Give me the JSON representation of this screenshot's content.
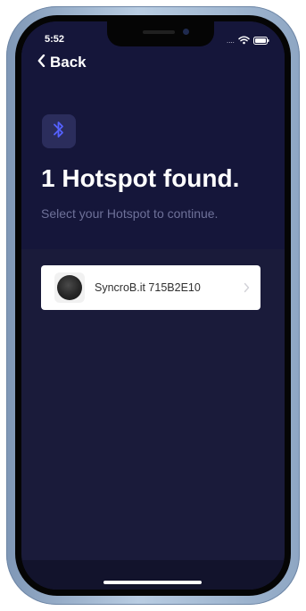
{
  "status_bar": {
    "time": "5:52",
    "signal_text": "....",
    "wifi_icon": "wifi-icon",
    "battery_icon": "battery-icon"
  },
  "navigation": {
    "back_label": "Back",
    "back_icon": "chevron-left-icon"
  },
  "header": {
    "icon": "bluetooth-icon",
    "title": "1 Hotspot found.",
    "subtitle": "Select your Hotspot to continue."
  },
  "hotspots": [
    {
      "name": "SyncroB.it 715B2E10",
      "icon": "hotspot-device-icon",
      "chevron": "chevron-right-icon"
    }
  ],
  "colors": {
    "screen_background": "#1a1b3a",
    "header_background": "#15163a",
    "bluetooth_accent": "#5561ff",
    "subtitle_text": "#6e7199"
  }
}
